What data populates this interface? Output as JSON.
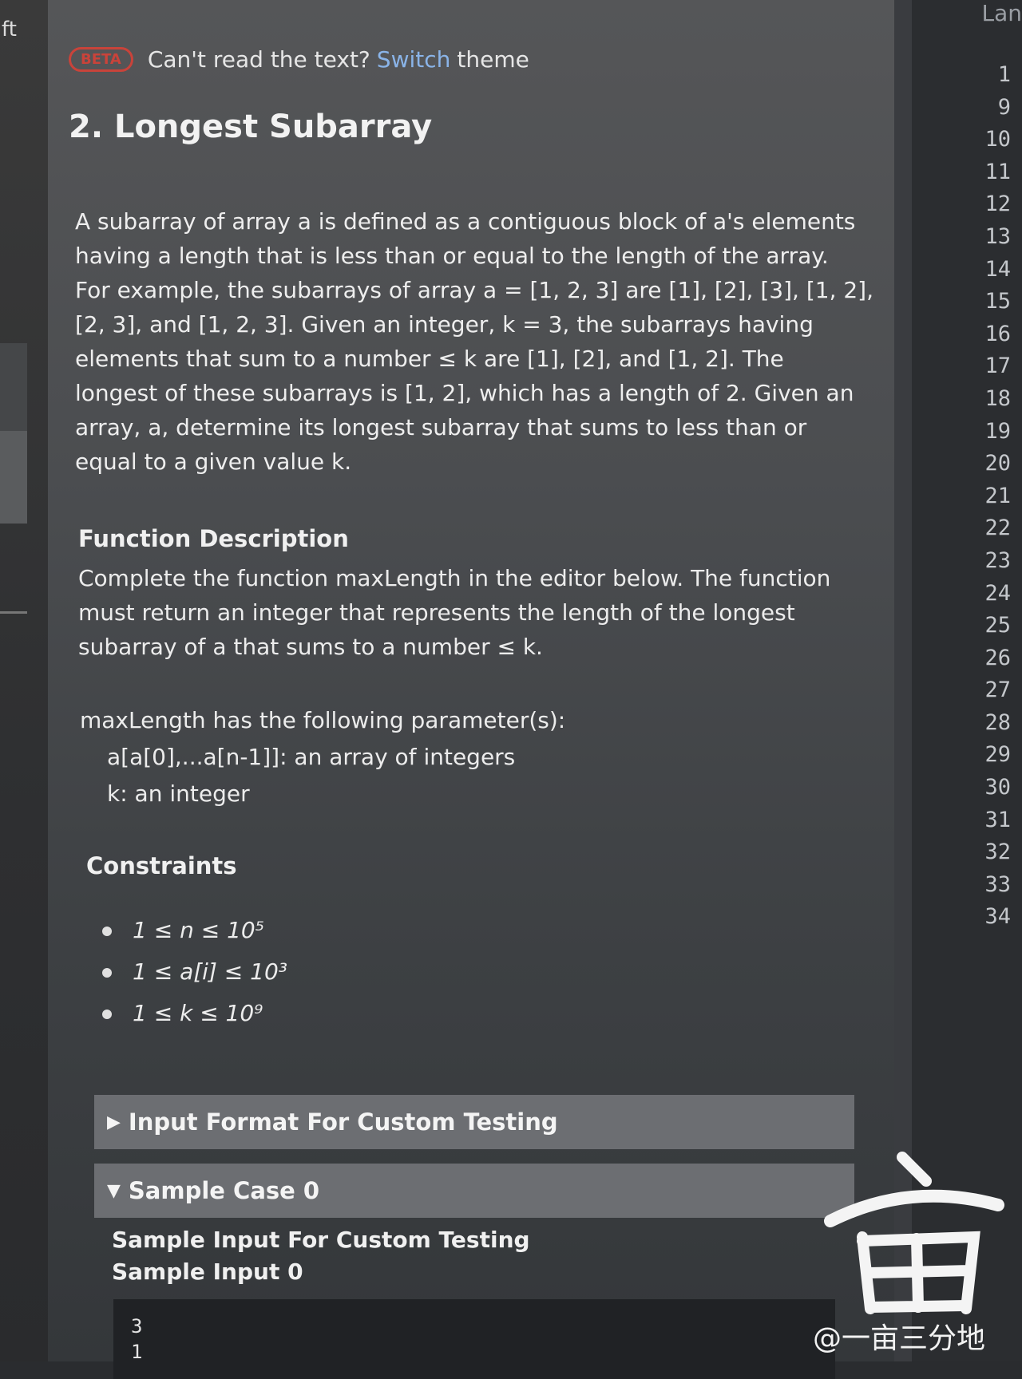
{
  "left_fragment": "ft",
  "banner": {
    "badge": "BETA",
    "question": "Can't read the text?",
    "link": "Switch",
    "link_rest": "theme"
  },
  "problem": {
    "title": "2. Longest Subarray",
    "statement_lines": [
      "A subarray of array a is defined as a contiguous block of a's elements",
      "having a length that is less than or equal to the length of the array.",
      "For example, the subarrays of array a = [1, 2, 3] are [1], [2], [3], [1, 2],",
      "[2, 3], and [1, 2, 3]. Given an integer, k = 3, the subarrays having",
      "elements that sum to a number ≤ k are [1], [2], and [1, 2]. The",
      "longest of these subarrays is [1, 2], which has a length of 2. Given an",
      "array, a, determine its longest subarray that sums to less than or",
      "equal to a given value k."
    ]
  },
  "function_description": {
    "heading": "Function Description",
    "lines": [
      "Complete the function maxLength in the editor below. The function",
      "must return an integer that represents the length of the longest",
      "subarray of a that sums to a number ≤ k."
    ],
    "params_intro": "maxLength has the following parameter(s):",
    "params": [
      "a[a[0],...a[n-1]]:  an array of integers",
      "k: an integer"
    ]
  },
  "constraints": {
    "heading": "Constraints",
    "items": [
      "1 ≤ n ≤ 10⁵",
      "1 ≤ a[i] ≤ 10³",
      "1 ≤ k ≤ 10⁹"
    ]
  },
  "accordions": {
    "input_format": "Input Format For Custom Testing",
    "sample_case": "Sample Case 0"
  },
  "sample": {
    "heading1": "Sample Input For Custom Testing",
    "heading2": "Sample Input 0",
    "code_lines": [
      "3",
      "1"
    ]
  },
  "editor": {
    "lang_label": "Lan",
    "line_numbers": [
      "1",
      "9",
      "10",
      "11",
      "12",
      "13",
      "14",
      "15",
      "16",
      "17",
      "18",
      "19",
      "20",
      "21",
      "22",
      "23",
      "24",
      "25",
      "26",
      "27",
      "28",
      "29",
      "30",
      "31",
      "32",
      "33",
      "34"
    ]
  },
  "watermark": {
    "glyph": "亩",
    "caption": "@一亩三分地"
  },
  "colors": {
    "panel": "#4b4d50",
    "badge": "#c9433a",
    "link": "#8ab4e8",
    "editor": "#2b2d30"
  }
}
